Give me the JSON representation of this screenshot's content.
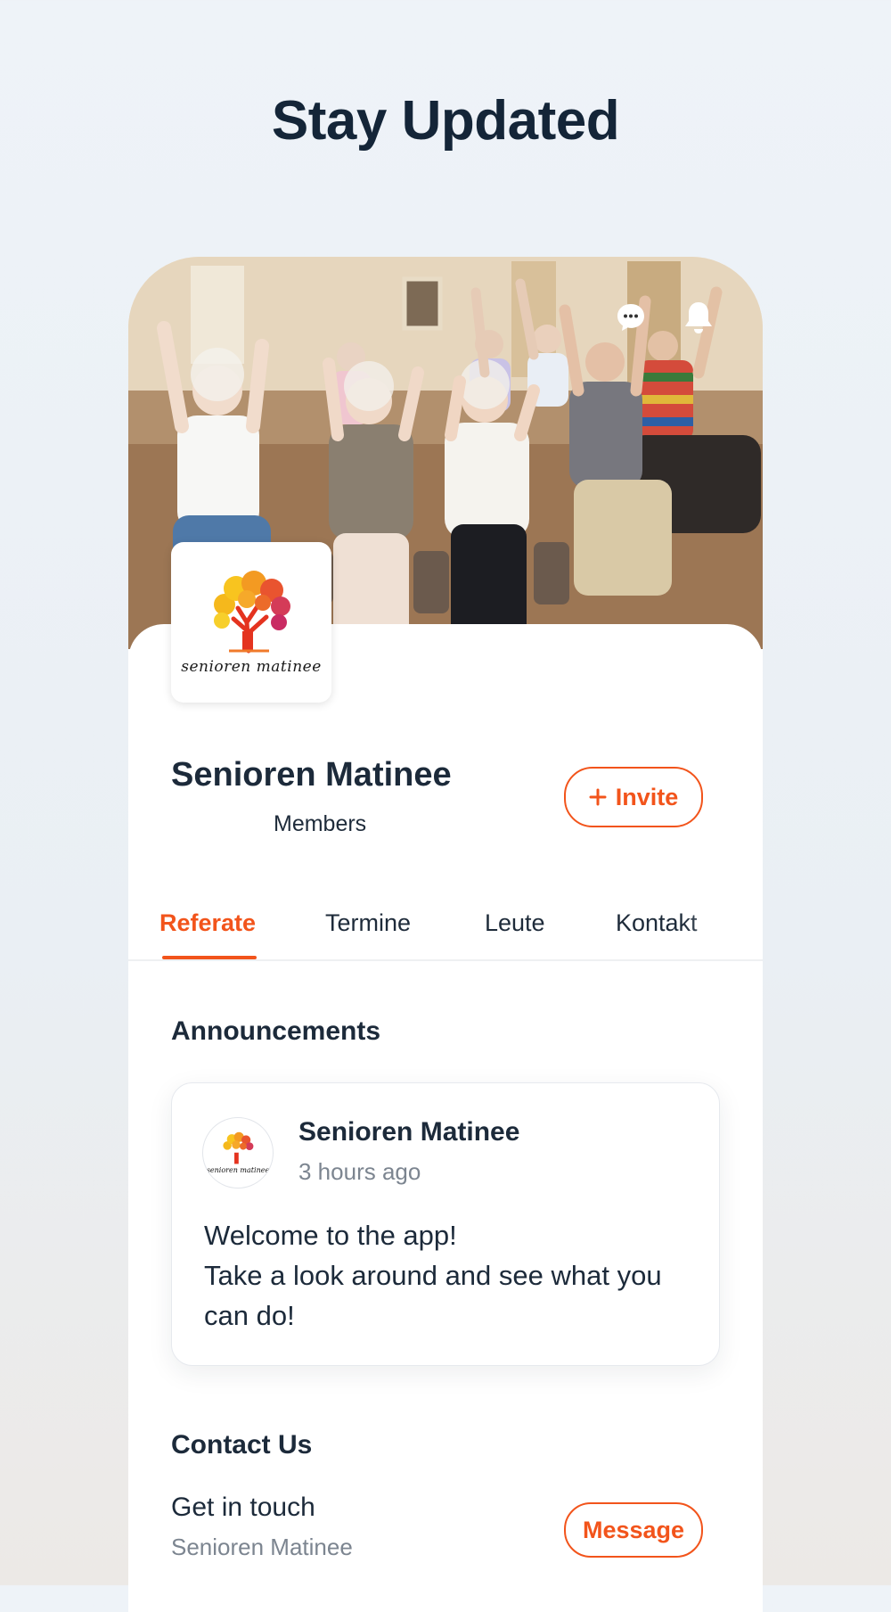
{
  "headline": "Stay Updated",
  "hero": {
    "image": "seniors-exercise-photo",
    "icons": [
      "chat-bubble-icon",
      "bell-icon"
    ]
  },
  "group": {
    "logo_text": "senioren matinee",
    "name": "Senioren Matinee",
    "members_label": "Members",
    "invite_label": "Invite",
    "invite_icon": "plus-icon"
  },
  "tabs": [
    {
      "label": "Referate",
      "active": true
    },
    {
      "label": "Termine",
      "active": false
    },
    {
      "label": "Leute",
      "active": false
    },
    {
      "label": "Kontakt",
      "active": false
    }
  ],
  "announcements": {
    "title": "Announcements",
    "post": {
      "author": "Senioren Matinee",
      "avatar_text": "senioren matinee",
      "time": "3 hours ago",
      "body": "Welcome to the app!\nTake a look around and see what you can do!"
    }
  },
  "contact": {
    "title": "Contact Us",
    "line1": "Get in touch",
    "line2": "Senioren Matinee",
    "message_label": "Message"
  },
  "colors": {
    "accent": "#f2541b",
    "text": "#1c2a3a",
    "muted": "#7c8590"
  }
}
